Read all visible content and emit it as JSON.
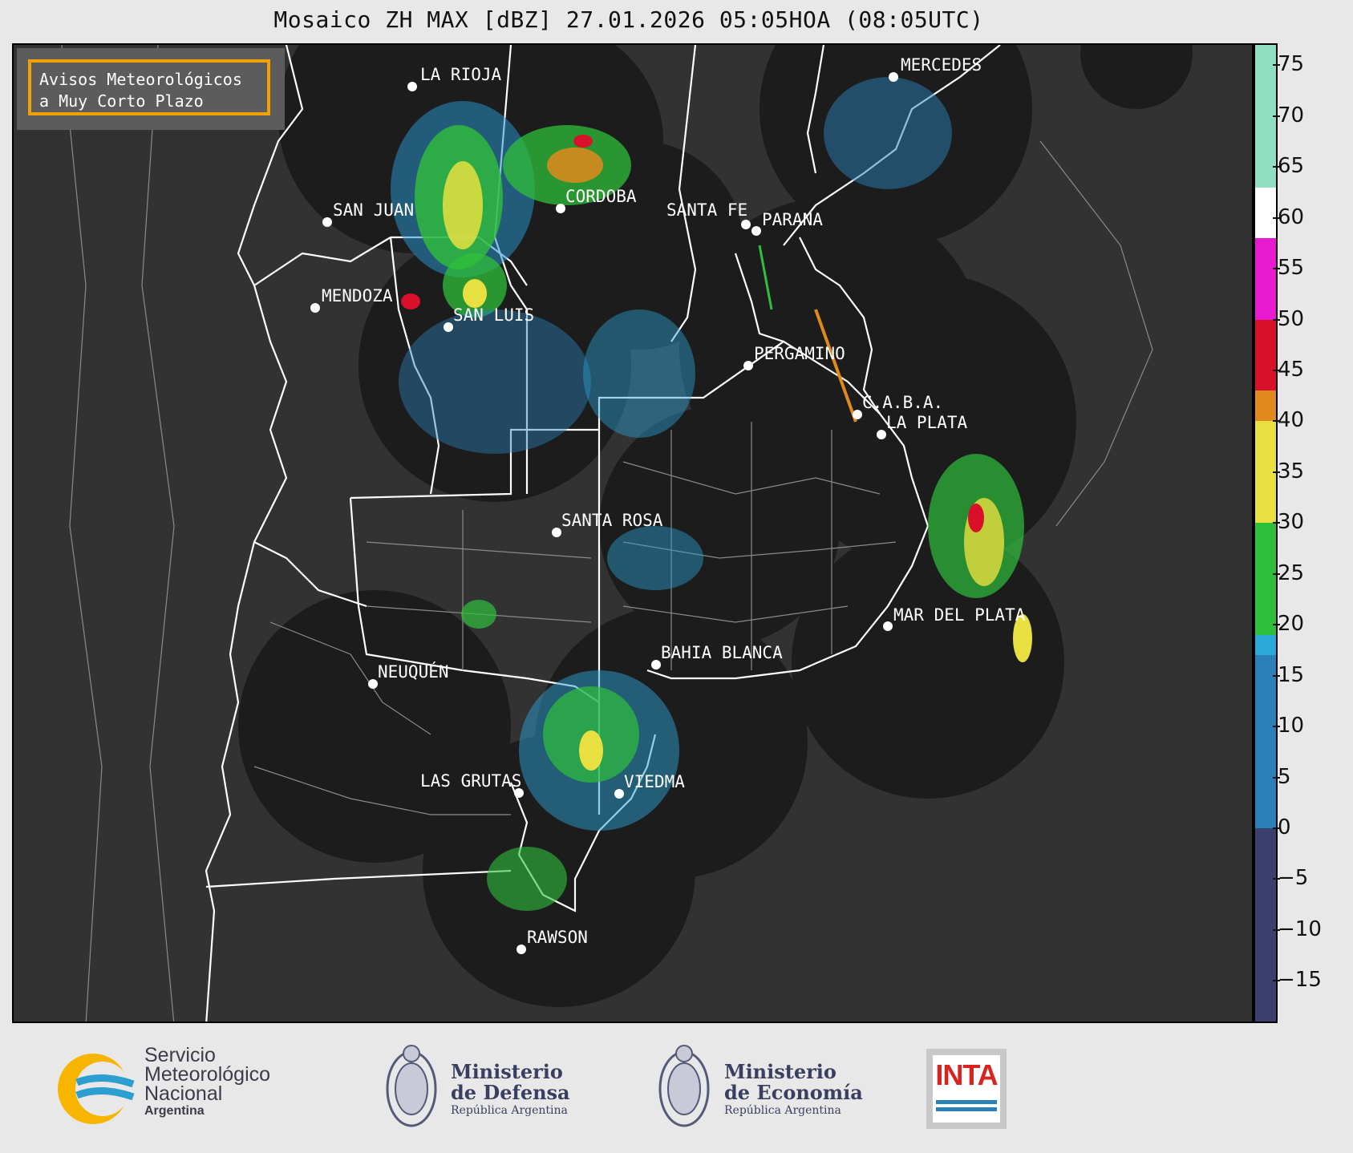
{
  "title": "Mosaico ZH MAX [dBZ] 27.01.2026 05:05HOA (08:05UTC)",
  "notice": {
    "line1": "Avisos Meteorológicos",
    "line2": "a Muy Corto Plazo"
  },
  "cities": [
    {
      "name": "LA RIOJA"
    },
    {
      "name": "MERCEDES"
    },
    {
      "name": "CORDOBA"
    },
    {
      "name": "SAN JUAN"
    },
    {
      "name": "SANTA FE"
    },
    {
      "name": "PARANA"
    },
    {
      "name": "MENDOZA"
    },
    {
      "name": "SAN LUIS"
    },
    {
      "name": "PERGAMINO"
    },
    {
      "name": "C.A.B.A."
    },
    {
      "name": "LA PLATA"
    },
    {
      "name": "SANTA ROSA"
    },
    {
      "name": "MAR DEL PLATA"
    },
    {
      "name": "BAHIA BLANCA"
    },
    {
      "name": "NEUQUÉN"
    },
    {
      "name": "LAS GRUTAS"
    },
    {
      "name": "VIEDMA"
    },
    {
      "name": "RAWSON"
    }
  ],
  "colorbar": {
    "unit": "dBZ",
    "min": -19,
    "max": 77,
    "ticks": [
      "75",
      "70",
      "65",
      "60",
      "55",
      "50",
      "45",
      "40",
      "35",
      "30",
      "25",
      "20",
      "15",
      "10",
      "5",
      "0",
      "−5",
      "−10",
      "−15"
    ],
    "colors": {
      "low": "#3a3f6e",
      "blue": "#2a7fb8",
      "cyan": "#2aa9d8",
      "green": "#2fbf3a",
      "yellow": "#e8e040",
      "orange": "#e08a1e",
      "red": "#d8102a",
      "magenta": "#e81ad0",
      "white": "#ffffff",
      "mint": "#8fe0c0"
    }
  },
  "footer": {
    "smn_line1": "Servicio",
    "smn_line2": "Meteorológico",
    "smn_line3": "Nacional",
    "smn_line4": "Argentina",
    "defensa_line1": "Ministerio",
    "defensa_line2": "de Defensa",
    "defensa_line3": "República Argentina",
    "economia_line1": "Ministerio",
    "economia_line2": "de Economía",
    "economia_line3": "República Argentina",
    "inta": "INTA"
  }
}
